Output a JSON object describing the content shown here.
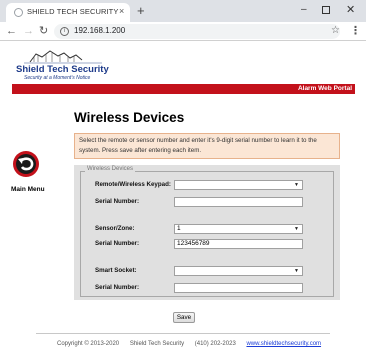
{
  "browser": {
    "tab_title": "SHIELD TECH SECURITY",
    "tab_close": "×",
    "new_tab": "+",
    "url": "192.168.1.200",
    "info_glyph": "i",
    "back_glyph": "←",
    "forward_glyph": "→",
    "reload_glyph": "↻",
    "star_glyph": "☆",
    "menu_glyph": "⋮",
    "min_glyph": "–",
    "close_glyph": "✕"
  },
  "header": {
    "brand": "Shield Tech Security",
    "tagline": "Security at a Moment's Notice",
    "portal": "Alarm Web Portal",
    "brand_color": "#1e3b8a",
    "bar_color": "#c3111b"
  },
  "nav": {
    "main_menu": "Main Menu",
    "icon": "back-arrow-icon"
  },
  "page": {
    "title": "Wireless Devices",
    "instructions": "Select the remote or sensor number and enter it's 9-digit serial number to learn it to the system. Press save after entering each item.",
    "legend": "Wireless Devices",
    "save_label": "Save"
  },
  "form": {
    "remote_label": "Remote/Wireless Keypad:",
    "remote_value": "",
    "remote_serial_label": "Serial Number:",
    "remote_serial_value": "",
    "sensor_label": "Sensor/Zone:",
    "sensor_value": "1",
    "sensor_serial_label": "Serial Number:",
    "sensor_serial_value": "123456789",
    "socket_label": "Smart Socket:",
    "socket_value": "",
    "socket_serial_label": "Serial Number:",
    "socket_serial_value": "",
    "caret": "▼"
  },
  "footer": {
    "copyright": "Copyright © 2013-2020",
    "company": "Shield Tech Security",
    "phone": "(410) 202-2023",
    "website": "www.shieldtechsecurity.com"
  }
}
